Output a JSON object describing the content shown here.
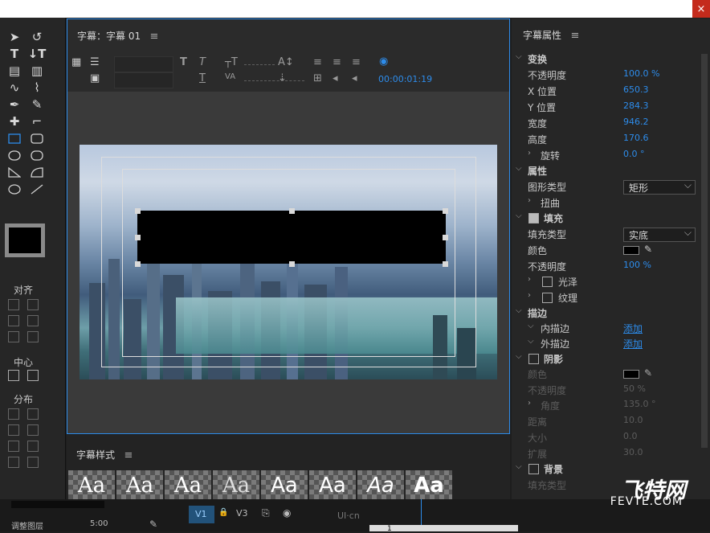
{
  "window": {
    "close": "×"
  },
  "main": {
    "title": "字幕：字幕 01",
    "menu": "≡",
    "timecode": "00:00:01:19"
  },
  "left": {
    "align": "对齐",
    "center": "中心",
    "distribute": "分布"
  },
  "styles": {
    "title": "字幕样式",
    "menu": "≡",
    "sample": "Aa"
  },
  "right": {
    "title": "字幕属性",
    "menu": "≡",
    "transform": "变换",
    "opacity": "不透明度",
    "opacity_val": "100.0 %",
    "x": "X 位置",
    "x_val": "650.3",
    "y": "Y 位置",
    "y_val": "284.3",
    "width": "宽度",
    "width_val": "946.2",
    "height": "高度",
    "height_val": "170.6",
    "rotate": "旋转",
    "rotate_val": "0.0 °",
    "props": "属性",
    "gtype": "图形类型",
    "gtype_val": "矩形",
    "distort": "扭曲",
    "fill": "填充",
    "ftype": "填充类型",
    "ftype_val": "实底",
    "color": "颜色",
    "fill_op": "不透明度",
    "fill_op_val": "100 %",
    "sheen": "光泽",
    "texture": "纹理",
    "stroke": "描边",
    "inner": "内描边",
    "outer": "外描边",
    "add": "添加",
    "shadow": "阴影",
    "s_color": "颜色",
    "s_op": "不透明度",
    "s_op_val": "50 %",
    "s_angle": "角度",
    "s_angle_val": "135.0 °",
    "s_dist": "距离",
    "s_dist_val": "10.0",
    "s_size": "大小",
    "s_size_val": "0.0",
    "s_spread": "扩展",
    "s_spread_val": "30.0",
    "bg": "背景",
    "bg_ftype": "填充类型"
  },
  "bottom": {
    "layer": "调整图层",
    "dur": "5:00",
    "v1": "V1",
    "v3": "V3",
    "track1": "1"
  },
  "watermark": {
    "logo": "飞特网",
    "site": "FEVTE.COM",
    "ui": "UI·cn"
  }
}
